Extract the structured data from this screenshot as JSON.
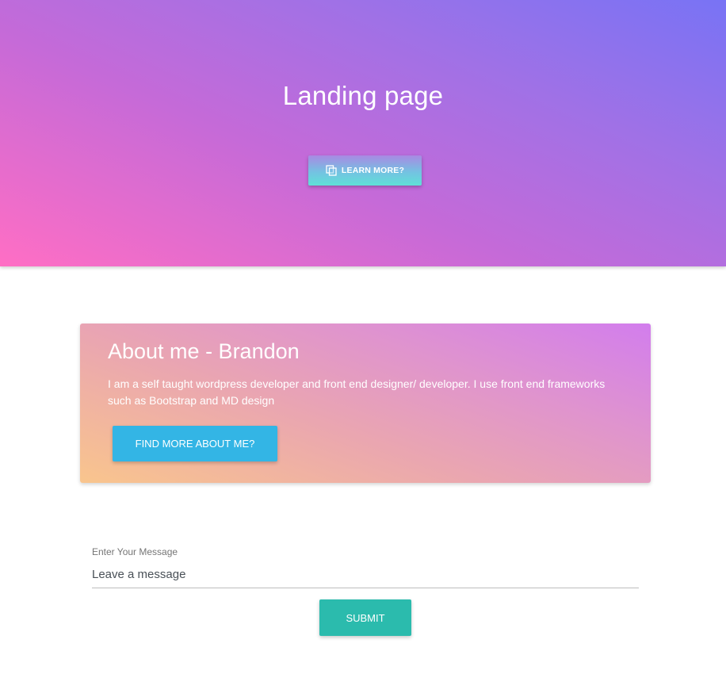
{
  "hero": {
    "title": "Landing page",
    "learn_more": {
      "label": "LEARN MORE?",
      "icon": "copy-icon"
    }
  },
  "about": {
    "title": "About me - Brandon",
    "description": "I am a self taught wordpress developer and front end designer/ developer. I use front end frameworks such as Bootstrap and MD design",
    "button_label": "FIND MORE ABOUT ME?"
  },
  "message_form": {
    "label": "Enter Your Message",
    "placeholder": "Leave a message",
    "submit_label": "SUBMIT"
  },
  "colors": {
    "hero_gradient": [
      "#ff6ec4",
      "#7873f5"
    ],
    "card_gradient": [
      "#f9c58d",
      "#d27ded"
    ],
    "info_button": "#33b5e5",
    "submit_button": "#2bbbad"
  }
}
